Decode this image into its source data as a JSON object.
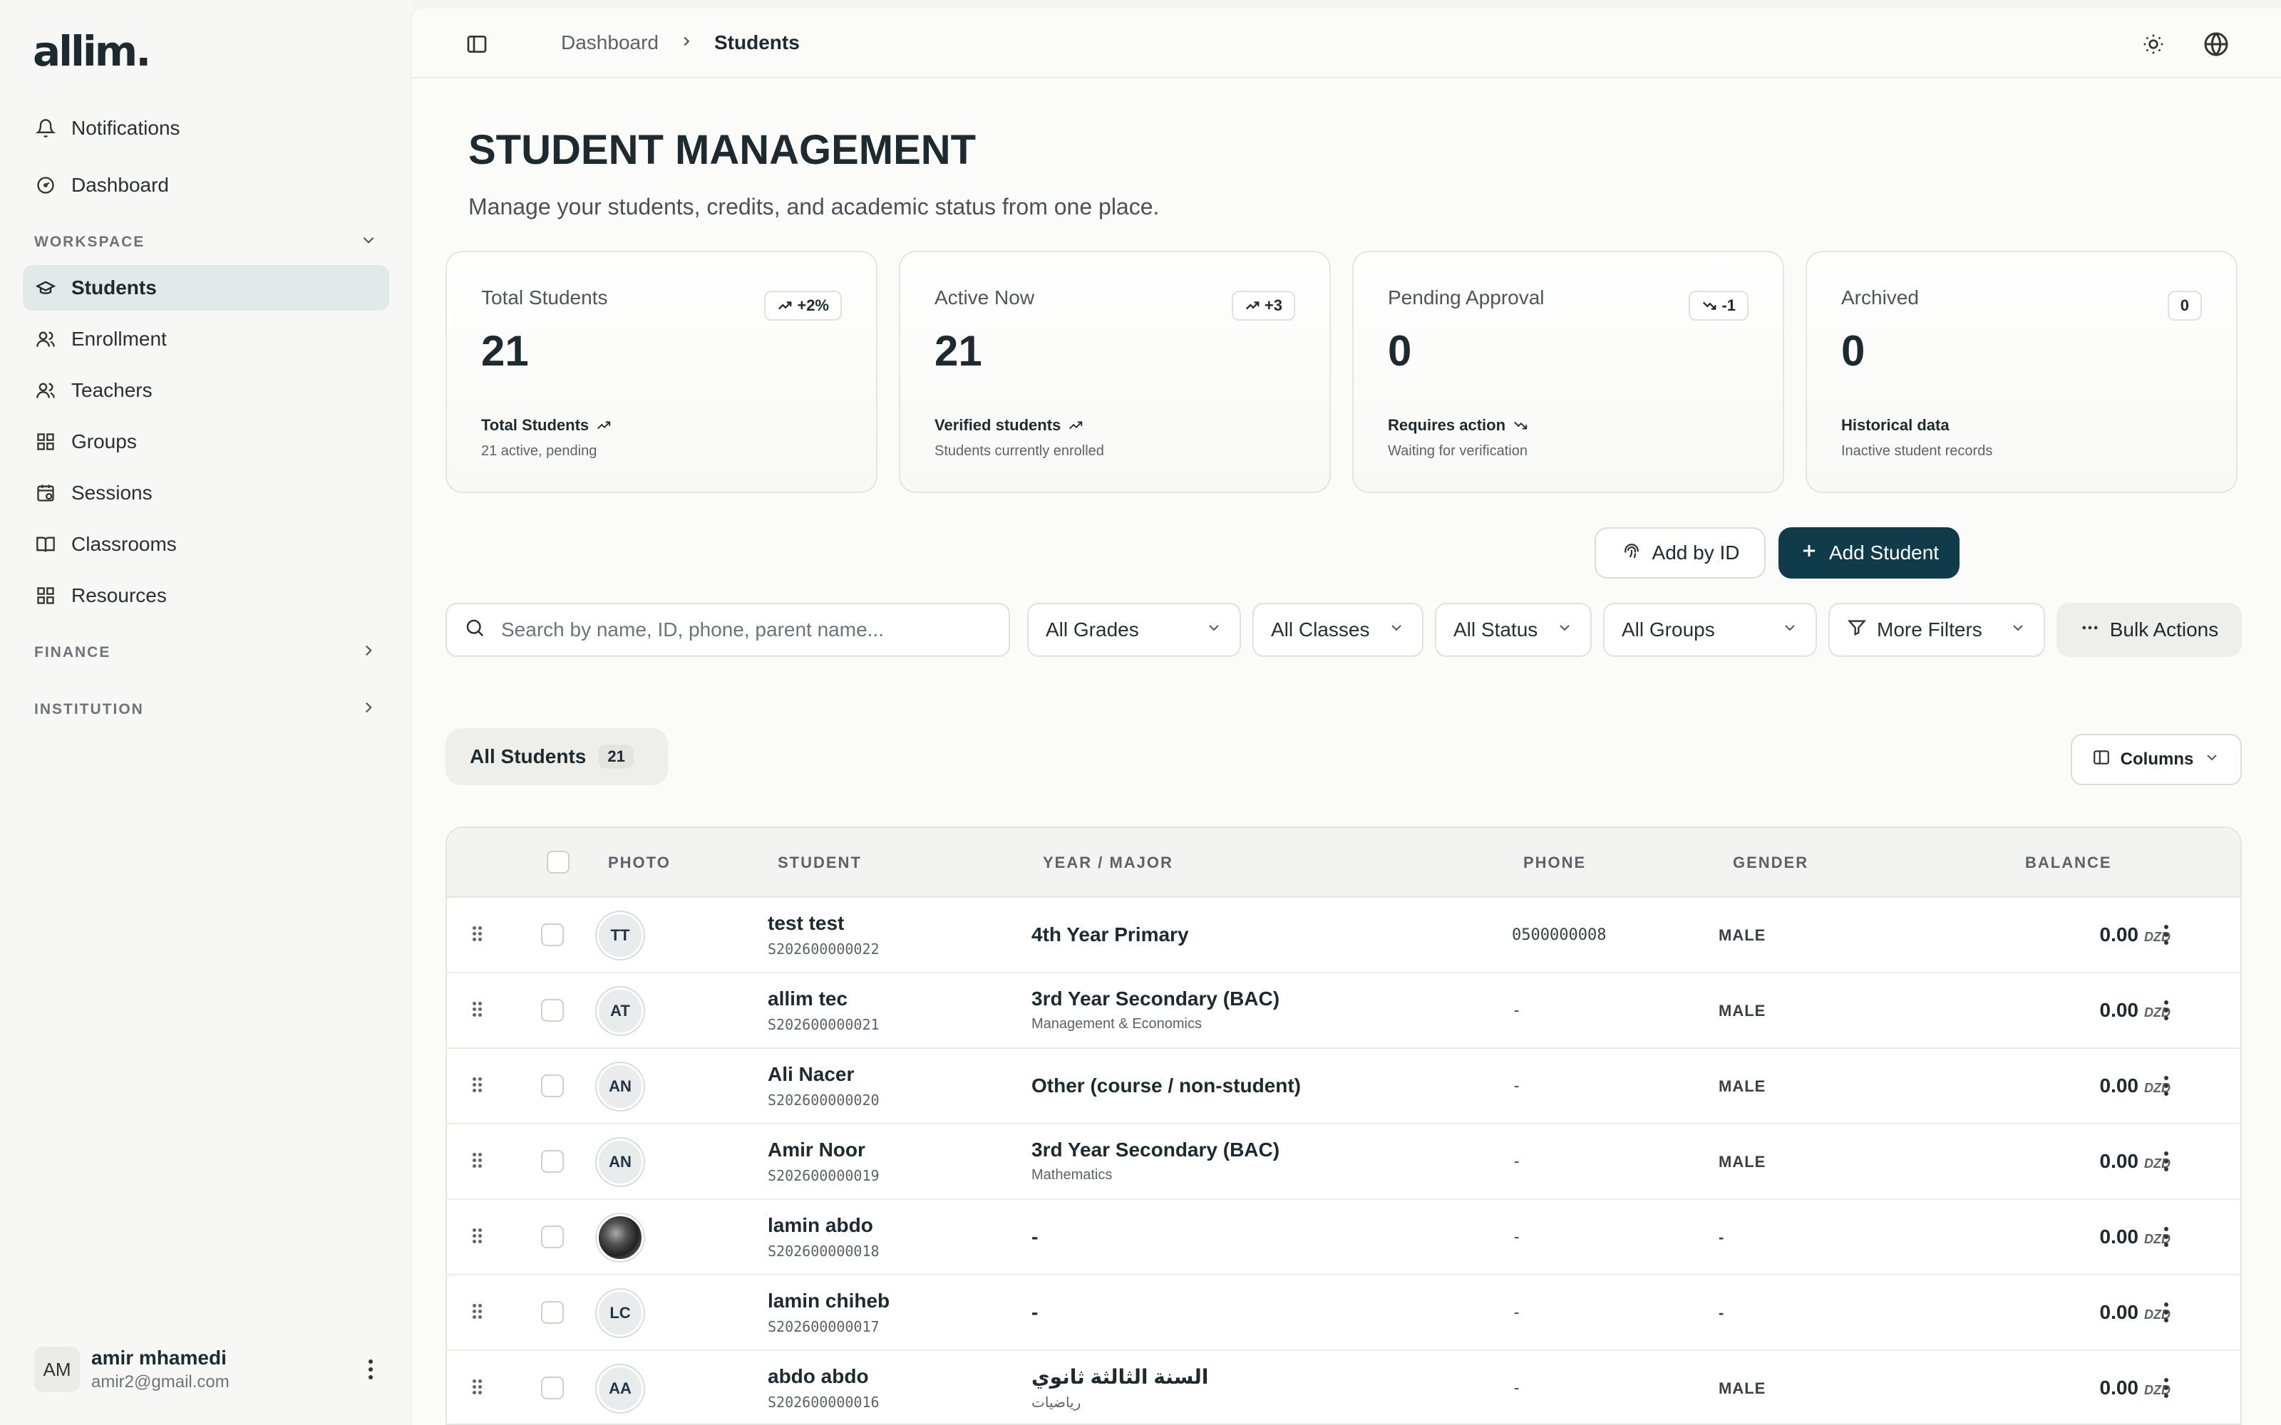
{
  "brand": {
    "logo": "allim."
  },
  "sidebar": {
    "top_items": [
      {
        "label": "Notifications",
        "icon": "bell-icon"
      },
      {
        "label": "Dashboard",
        "icon": "gauge-icon"
      }
    ],
    "workspace_label": "WORKSPACE",
    "workspace_items": [
      {
        "label": "Students",
        "icon": "graduation-cap-icon",
        "active": true
      },
      {
        "label": "Enrollment",
        "icon": "users-icon"
      },
      {
        "label": "Teachers",
        "icon": "users-icon"
      },
      {
        "label": "Groups",
        "icon": "grid-icon"
      },
      {
        "label": "Sessions",
        "icon": "calendar-clock-icon"
      },
      {
        "label": "Classrooms",
        "icon": "book-open-icon"
      },
      {
        "label": "Resources",
        "icon": "grid-icon"
      }
    ],
    "finance_label": "FINANCE",
    "institution_label": "INSTITUTION",
    "user": {
      "initials": "AM",
      "name": "amir mhamedi",
      "email": "amir2@gmail.com"
    }
  },
  "breadcrumb": {
    "parent": "Dashboard",
    "current": "Students"
  },
  "page": {
    "title": "STUDENT MANAGEMENT",
    "subtitle": "Manage your students, credits, and academic status from one place."
  },
  "stats": [
    {
      "label": "Total Students",
      "value": "21",
      "badge": "+2%",
      "trend": "up",
      "foot_title": "Total Students",
      "foot_sub": "21 active, pending"
    },
    {
      "label": "Active Now",
      "value": "21",
      "badge": "+3",
      "trend": "up",
      "foot_title": "Verified students",
      "foot_sub": "Students currently enrolled"
    },
    {
      "label": "Pending Approval",
      "value": "0",
      "badge": "-1",
      "trend": "down",
      "foot_title": "Requires action",
      "foot_sub": "Waiting for verification"
    },
    {
      "label": "Archived",
      "value": "0",
      "badge": "0",
      "trend": "none",
      "foot_title": "Historical data",
      "foot_sub": "Inactive student records"
    }
  ],
  "actions": {
    "add_by_id": "Add by ID",
    "add_student": "Add Student",
    "bulk_actions": "Bulk Actions"
  },
  "filters": {
    "search_placeholder": "Search by name, ID, phone, parent name...",
    "grades": "All Grades",
    "classes": "All Classes",
    "status": "All Status",
    "groups": "All Groups",
    "more": "More Filters"
  },
  "tabs": {
    "all_label": "All Students",
    "all_count": "21"
  },
  "columns_button": "Columns",
  "table": {
    "headers": {
      "photo": "PHOTO",
      "student": "STUDENT",
      "year_major": "YEAR / MAJOR",
      "phone": "PHONE",
      "gender": "GENDER",
      "balance": "BALANCE"
    },
    "currency": "DZD",
    "rows": [
      {
        "initials": "TT",
        "name": "test test",
        "id": "S202600000022",
        "year": "4th Year Primary",
        "major": "",
        "phone": "0500000008",
        "gender": "MALE",
        "balance": "0.00"
      },
      {
        "initials": "AT",
        "name": "allim tec",
        "id": "S202600000021",
        "year": "3rd Year Secondary (BAC)",
        "major": "Management & Economics",
        "phone": "-",
        "gender": "MALE",
        "balance": "0.00"
      },
      {
        "initials": "AN",
        "name": "Ali Nacer",
        "id": "S202600000020",
        "year": "Other (course / non-student)",
        "major": "",
        "phone": "-",
        "gender": "MALE",
        "balance": "0.00"
      },
      {
        "initials": "AN",
        "name": "Amir Noor",
        "id": "S202600000019",
        "year": "3rd Year Secondary (BAC)",
        "major": "Mathematics",
        "phone": "-",
        "gender": "MALE",
        "balance": "0.00"
      },
      {
        "initials": "",
        "name": "lamin abdo",
        "id": "S202600000018",
        "year": "-",
        "major": "",
        "phone": "-",
        "gender": "-",
        "balance": "0.00",
        "photo": true
      },
      {
        "initials": "LC",
        "name": "lamin chiheb",
        "id": "S202600000017",
        "year": "-",
        "major": "",
        "phone": "-",
        "gender": "-",
        "balance": "0.00"
      },
      {
        "initials": "AA",
        "name": "abdo abdo",
        "id": "S202600000016",
        "year": "السنة الثالثة ثانوي",
        "major": "رياضيات",
        "phone": "-",
        "gender": "MALE",
        "balance": "0.00"
      }
    ]
  }
}
